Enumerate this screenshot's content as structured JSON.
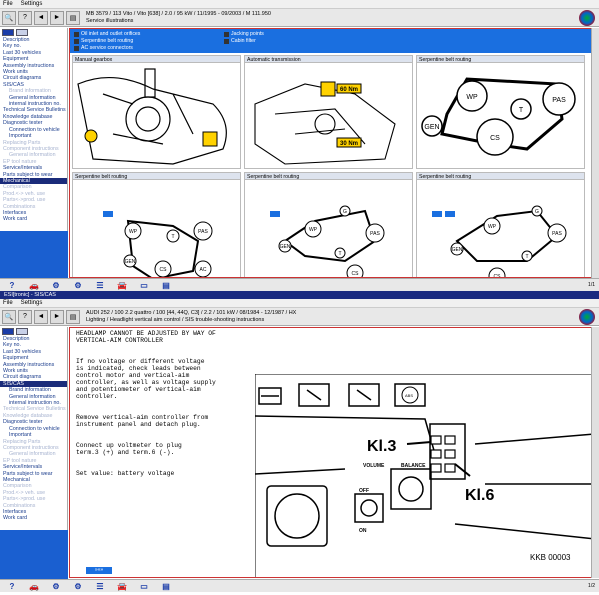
{
  "top": {
    "menu": [
      "File",
      "Settings"
    ],
    "vehicle_line1": "MB 3579 / 113 Vito / Vito [638] / 2.0 / 95 kW / 11/1995 - 09/2003 / M 111.950",
    "vehicle_line2": "Service illustrations",
    "nav": [
      {
        "label": "Description",
        "cls": ""
      },
      {
        "label": "Key no.",
        "cls": ""
      },
      {
        "label": "Last 30 vehicles",
        "cls": ""
      },
      {
        "label": "Equipment",
        "cls": ""
      },
      {
        "label": "Assembly instructions",
        "cls": ""
      },
      {
        "label": "Work units",
        "cls": ""
      },
      {
        "label": "Circuit diagrams",
        "cls": ""
      },
      {
        "label": "SIS/CAS",
        "cls": ""
      },
      {
        "label": "Brand information",
        "cls": "sub dim"
      },
      {
        "label": "General information",
        "cls": "sub"
      },
      {
        "label": "internal instruction no.",
        "cls": "sub"
      },
      {
        "label": "Technical Service Bulletins",
        "cls": ""
      },
      {
        "label": "Knowledge database",
        "cls": ""
      },
      {
        "label": "Diagnostic tester",
        "cls": ""
      },
      {
        "label": "Connection to vehicle",
        "cls": "sub"
      },
      {
        "label": "Important",
        "cls": "sub"
      },
      {
        "label": "Replacing Parts",
        "cls": "dim"
      },
      {
        "label": "Component instructions",
        "cls": "dim"
      },
      {
        "label": "General information",
        "cls": "sub dim"
      },
      {
        "label": "EP tool nature",
        "cls": "dim"
      },
      {
        "label": "Service/Intervals",
        "cls": ""
      },
      {
        "label": "Parts subject to wear",
        "cls": ""
      },
      {
        "label": "Mechanical",
        "cls": "sel"
      },
      {
        "label": "Comparison",
        "cls": "dim"
      },
      {
        "label": "Prod.<-> veh. use",
        "cls": "dim"
      },
      {
        "label": "Parts<->prod. use",
        "cls": "dim"
      },
      {
        "label": "Combinations",
        "cls": "dim"
      },
      {
        "label": "Interfaces",
        "cls": ""
      },
      {
        "label": "Work card",
        "cls": ""
      }
    ],
    "checks": [
      {
        "label": "Oil inlet and outlet orifices",
        "on": true
      },
      {
        "label": "Jacking points",
        "on": true
      },
      {
        "label": "Serpentine belt routing",
        "on": true
      },
      {
        "label": "Cabin filter",
        "on": true
      },
      {
        "label": "AC service connectors",
        "on": true
      }
    ],
    "cells": [
      "Manual gearbox",
      "Automatic transmission",
      "Serpentine belt routing",
      "Serpentine belt routing",
      "Serpentine belt routing",
      "Serpentine belt routing"
    ],
    "torque1": "60 Nm",
    "torque2": "30 Nm",
    "belt_labels": {
      "wp": "WP",
      "pas": "PAS",
      "t": "T",
      "gen": "GEN",
      "cs": "CS",
      "ac": "AC",
      "g": "G"
    },
    "page": "1/1"
  },
  "taskbar": "ESI[tronic] - SIS/CAS",
  "bottom": {
    "menu": [
      "File",
      "Settings"
    ],
    "vehicle_line1": "AUDI 252 / 100 2.2 quattro / 100 [44, 44Q, C3] / 2.2 / 101 kW / 08/1984 - 12/1987 / HX",
    "vehicle_line2": "Lighting / Headlight vertical aim control / SIS trouble-shooting instructions",
    "nav": [
      {
        "label": "Description",
        "cls": ""
      },
      {
        "label": "Key no.",
        "cls": ""
      },
      {
        "label": "Last 30 vehicles",
        "cls": ""
      },
      {
        "label": "Equipment",
        "cls": ""
      },
      {
        "label": "Assembly instructions",
        "cls": ""
      },
      {
        "label": "Work units",
        "cls": ""
      },
      {
        "label": "Circuit diagrams",
        "cls": ""
      },
      {
        "label": "SIS/CAS",
        "cls": "sel"
      },
      {
        "label": "Brand information",
        "cls": "sub"
      },
      {
        "label": "General information",
        "cls": "sub"
      },
      {
        "label": "internal instruction no.",
        "cls": "sub"
      },
      {
        "label": "Technical Service Bulletins",
        "cls": "dim"
      },
      {
        "label": "Knowledge database",
        "cls": "dim"
      },
      {
        "label": "Diagnostic tester",
        "cls": ""
      },
      {
        "label": "Connection to vehicle",
        "cls": "sub"
      },
      {
        "label": "Important",
        "cls": "sub"
      },
      {
        "label": "Replacing Parts",
        "cls": "dim"
      },
      {
        "label": "Component instructions",
        "cls": "dim"
      },
      {
        "label": "General information",
        "cls": "sub dim"
      },
      {
        "label": "EP tool nature",
        "cls": "dim"
      },
      {
        "label": "Service/Intervals",
        "cls": ""
      },
      {
        "label": "Parts subject to wear",
        "cls": ""
      },
      {
        "label": "Mechanical",
        "cls": ""
      },
      {
        "label": "Comparison",
        "cls": "dim"
      },
      {
        "label": "Prod.<-> veh. use",
        "cls": "dim"
      },
      {
        "label": "Parts<->prod. use",
        "cls": "dim"
      },
      {
        "label": "Combinations",
        "cls": "dim"
      },
      {
        "label": "Interfaces",
        "cls": ""
      },
      {
        "label": "Work card",
        "cls": ""
      }
    ],
    "doc_title": "HEADLAMP CANNOT BE ADJUSTED BY WAY OF\nVERTICAL-AIM CONTROLLER",
    "doc_p1": "If no voltage or different voltage\nis indicated, check leads between\ncontrol motor and vertical-aim\ncontroller, as well as voltage supply\nand potentiometer of vertical-aim\ncontroller.",
    "doc_p2": "Remove vertical-aim controller from\ninstrument panel and detach plug.",
    "doc_p3": "Connect up voltmeter to plug\nterm.3 (+) and term.6 (-).",
    "doc_p4": "Set value: battery voltage",
    "kl3": "Kl.3",
    "kl6": "Kl.6",
    "fig_id": "KKB 00003",
    "volume": "VOLUME",
    "balance": "BALANCE",
    "off": "OFF",
    "on": "ON",
    "more": "»»»",
    "page": "1/2"
  }
}
